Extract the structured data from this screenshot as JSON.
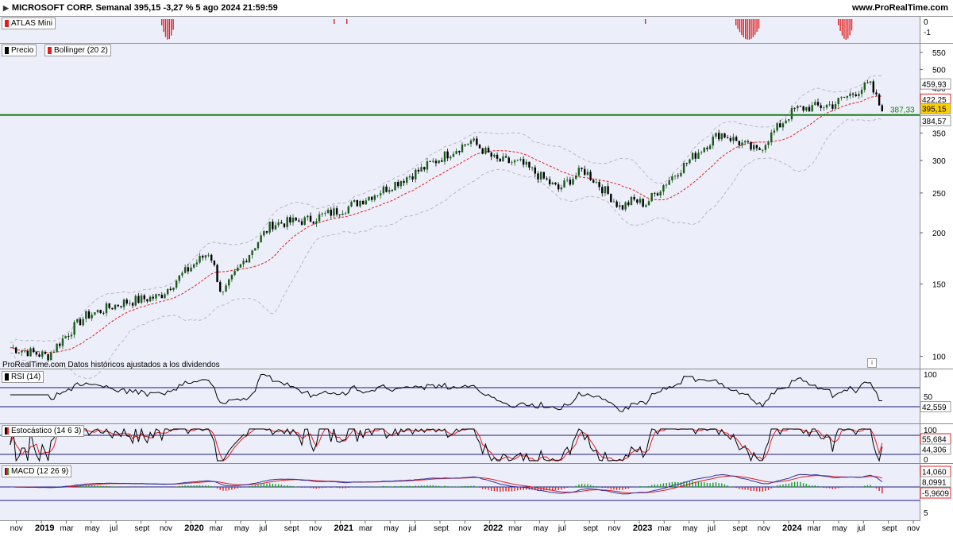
{
  "header": {
    "title": "MICROSOFT CORP. Semanal 395,15 -3,27 % 5 ago 2024 21:59:59",
    "site": "www.ProRealTime.com"
  },
  "panels": {
    "atlas": {
      "label": "ATLAS Mini",
      "color": "#e02020",
      "ticks": [
        "0",
        "-1"
      ]
    },
    "price": {
      "label_price": "Precio",
      "label_boll": "Bollinger (20 2)",
      "ticks": [
        "550",
        "500",
        "450",
        "400",
        "350",
        "300",
        "250",
        "200",
        "150",
        "100"
      ],
      "hline_value": "387,33",
      "tag_upper": "459,93",
      "tag_mid": "422,25",
      "tag_last": "395,15",
      "tag_lower": "384,57",
      "note": "ProRealTime.com Datos históricos ajustados a los dividendos"
    },
    "rsi": {
      "label": "RSI (14)",
      "ticks": [
        "100",
        "50"
      ],
      "value": "42,559"
    },
    "stoch": {
      "label": "Estocástico (14 6 3)",
      "ticks": [
        "100",
        "50",
        "0"
      ],
      "value1": "55,684",
      "value2": "44,306"
    },
    "macd": {
      "label": "MACD (12 26 9)",
      "ticks": [
        "5"
      ],
      "value1": "14,060",
      "value2": "8,0991",
      "value3": "-5,9609"
    }
  },
  "xaxis": {
    "labels": [
      "nov",
      "2019",
      "mar",
      "may",
      "jul",
      "sept",
      "nov",
      "2020",
      "mar",
      "may",
      "jul",
      "sept",
      "nov",
      "2021",
      "mar",
      "may",
      "jul",
      "sept",
      "nov",
      "2022",
      "mar",
      "may",
      "jul",
      "sept",
      "nov",
      "2023",
      "mar",
      "may",
      "jul",
      "sept",
      "nov",
      "2024",
      "mar",
      "may",
      "jul",
      "sept",
      "nov"
    ],
    "bold": [
      "2019",
      "2020",
      "2021",
      "2022",
      "2023",
      "2024"
    ]
  },
  "colors": {
    "up": "#1a5c1a",
    "down": "#000000",
    "mid": "#e02020",
    "band": "#b8b8c4",
    "hline": "#1a7f1a",
    "rsi_line": "#1a1a7f"
  },
  "chart_data": {
    "type": "candlestick",
    "title": "MICROSOFT CORP. Semanal",
    "x_range": [
      "2018-10",
      "2024-11"
    ],
    "ylim": [
      95,
      560
    ],
    "price_waypoints": [
      {
        "date": "2018-10",
        "close": 105
      },
      {
        "date": "2019-01",
        "close": 100
      },
      {
        "date": "2019-04",
        "close": 125
      },
      {
        "date": "2019-07",
        "close": 135
      },
      {
        "date": "2019-10",
        "close": 140
      },
      {
        "date": "2020-02",
        "close": 180
      },
      {
        "date": "2020-03",
        "close": 140
      },
      {
        "date": "2020-07",
        "close": 210
      },
      {
        "date": "2020-10",
        "close": 215
      },
      {
        "date": "2021-01",
        "close": 230
      },
      {
        "date": "2021-04",
        "close": 255
      },
      {
        "date": "2021-07",
        "close": 285
      },
      {
        "date": "2021-11",
        "close": 335
      },
      {
        "date": "2022-01",
        "close": 300
      },
      {
        "date": "2022-03",
        "close": 295
      },
      {
        "date": "2022-06",
        "close": 255
      },
      {
        "date": "2022-08",
        "close": 285
      },
      {
        "date": "2022-11",
        "close": 230
      },
      {
        "date": "2022-12",
        "close": 240
      },
      {
        "date": "2023-01",
        "close": 235
      },
      {
        "date": "2023-04",
        "close": 290
      },
      {
        "date": "2023-07",
        "close": 350
      },
      {
        "date": "2023-10",
        "close": 315
      },
      {
        "date": "2024-01",
        "close": 400
      },
      {
        "date": "2024-04",
        "close": 410
      },
      {
        "date": "2024-07",
        "close": 460
      },
      {
        "date": "2024-08",
        "close": 395
      }
    ],
    "last_close": 395.15,
    "support_line": 387.33,
    "bollinger": {
      "upper": 459.93,
      "mid": 422.25,
      "lower": 384.57
    },
    "rsi_last": 42.559,
    "stochastic_last": [
      55.684,
      44.306
    ],
    "macd_last": [
      14.06,
      8.0991,
      -5.9609
    ]
  }
}
